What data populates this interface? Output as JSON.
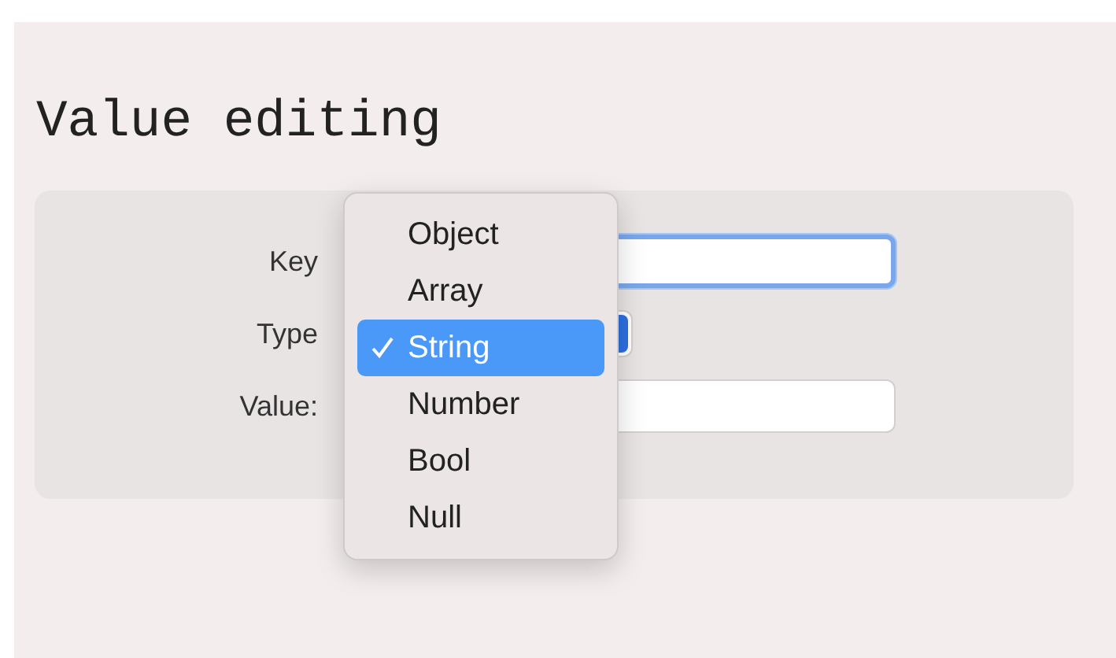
{
  "title": "Value editing",
  "form": {
    "fields": [
      {
        "label": "Key",
        "kind": "text",
        "focused": true
      },
      {
        "label": "Type",
        "kind": "popup"
      },
      {
        "label": "Value:",
        "kind": "text",
        "focused": false
      }
    ]
  },
  "menu": {
    "items": [
      {
        "label": "Object",
        "selected": false
      },
      {
        "label": "Array",
        "selected": false
      },
      {
        "label": "String",
        "selected": true
      },
      {
        "label": "Number",
        "selected": false
      },
      {
        "label": "Bool",
        "selected": false
      },
      {
        "label": "Null",
        "selected": false
      }
    ]
  }
}
